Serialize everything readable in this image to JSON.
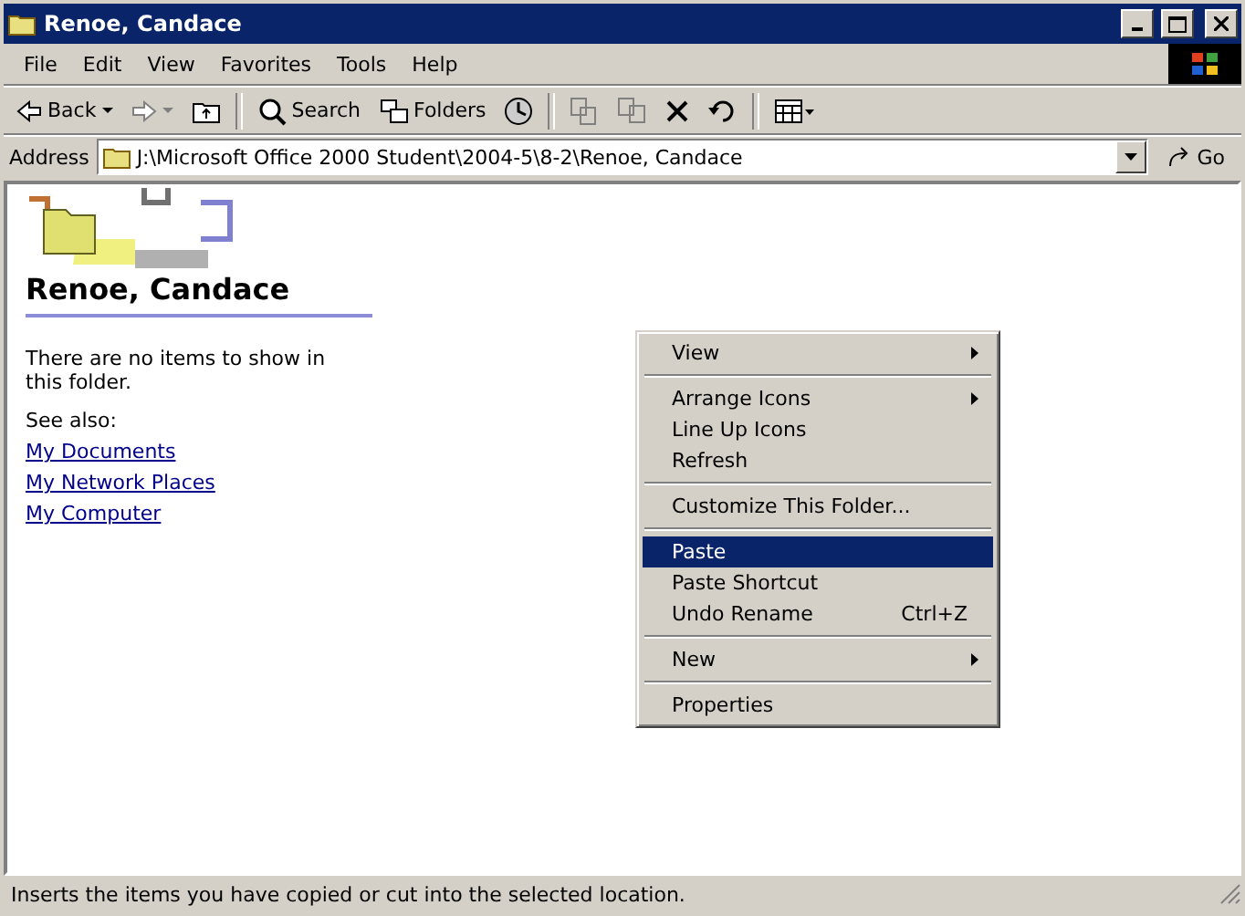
{
  "window": {
    "title": "Renoe, Candace"
  },
  "menu_bar": [
    "File",
    "Edit",
    "View",
    "Favorites",
    "Tools",
    "Help"
  ],
  "toolbar": [
    {
      "kind": "back",
      "label": "Back",
      "disabled": false
    },
    {
      "kind": "forward",
      "disabled": true
    },
    {
      "kind": "up",
      "disabled": false
    },
    {
      "kind": "search",
      "label": "Search",
      "disabled": false
    },
    {
      "kind": "folders",
      "label": "Folders",
      "disabled": false
    },
    {
      "kind": "history",
      "disabled": false
    },
    {
      "kind": "move",
      "disabled": true
    },
    {
      "kind": "copy",
      "disabled": true
    },
    {
      "kind": "delete",
      "disabled": false
    },
    {
      "kind": "undo",
      "disabled": false
    },
    {
      "kind": "views",
      "disabled": false
    }
  ],
  "address": {
    "label": "Address",
    "value": "J:\\Microsoft Office 2000 Student\\2004-5\\8-2\\Renoe, Candace",
    "go": "Go"
  },
  "side_panel": {
    "heading": "Renoe, Candace",
    "message": "There are no items to show in this folder.",
    "see_also": "See also:",
    "links": [
      "My Documents",
      "My Network Places",
      "My Computer"
    ]
  },
  "context_menu": [
    {
      "kind": "item",
      "label": "View",
      "submenu": true,
      "selected": false
    },
    {
      "kind": "separator"
    },
    {
      "kind": "item",
      "label": "Arrange Icons",
      "submenu": true,
      "selected": false
    },
    {
      "kind": "item",
      "label": "Line Up Icons",
      "submenu": false,
      "selected": false
    },
    {
      "kind": "item",
      "label": "Refresh",
      "submenu": false,
      "selected": false
    },
    {
      "kind": "separator"
    },
    {
      "kind": "item",
      "label": "Customize This Folder...",
      "submenu": false,
      "selected": false
    },
    {
      "kind": "separator"
    },
    {
      "kind": "item",
      "label": "Paste",
      "submenu": false,
      "selected": true
    },
    {
      "kind": "item",
      "label": "Paste Shortcut",
      "submenu": false,
      "selected": false
    },
    {
      "kind": "item",
      "label": "Undo Rename",
      "shortcut": "Ctrl+Z",
      "submenu": false,
      "selected": false
    },
    {
      "kind": "separator"
    },
    {
      "kind": "item",
      "label": "New",
      "submenu": true,
      "selected": false
    },
    {
      "kind": "separator"
    },
    {
      "kind": "item",
      "label": "Properties",
      "submenu": false,
      "selected": false
    }
  ],
  "status_bar": "Inserts the items you have copied or cut into the selected location."
}
